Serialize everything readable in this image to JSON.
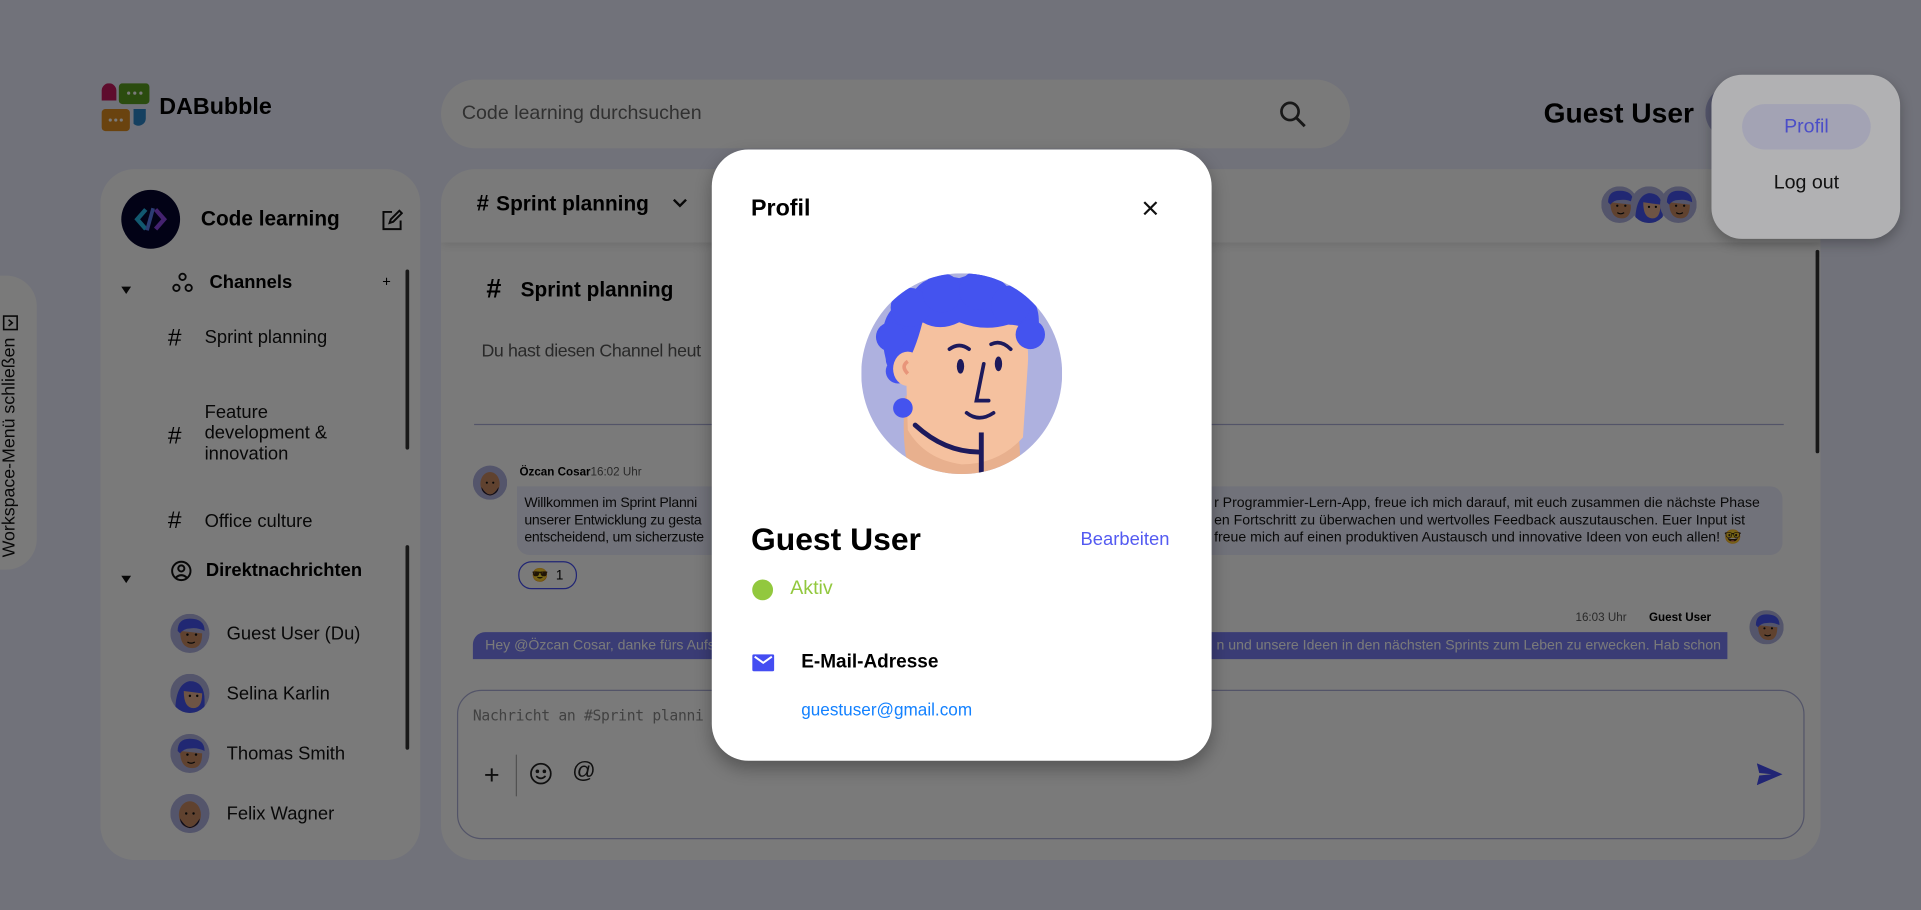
{
  "app": {
    "name": "DABubble"
  },
  "search": {
    "placeholder": "Code learning durchsuchen"
  },
  "header": {
    "user_name": "Guest User"
  },
  "user_menu": {
    "items": [
      {
        "label": "Profil"
      },
      {
        "label": "Log out"
      }
    ]
  },
  "workspace_toggle": {
    "label": "Workspace-Menü schließen"
  },
  "sidebar": {
    "workspace_name": "Code learning",
    "channels_title": "Channels",
    "channels": [
      {
        "label": "Sprint planning"
      },
      {
        "label": "Feature development & innovation"
      },
      {
        "label": "Office culture"
      }
    ],
    "dm_title": "Direktnachrichten",
    "dms": [
      {
        "label": "Guest User (Du)"
      },
      {
        "label": "Selina Karlin"
      },
      {
        "label": "Thomas Smith"
      },
      {
        "label": "Felix Wagner"
      }
    ]
  },
  "channel": {
    "title": "Sprint planning",
    "intro_title": "Sprint planning",
    "intro_text": "Du hast diesen Channel heut",
    "messages": [
      {
        "author": "Özcan Cosar",
        "time": "16:02 Uhr",
        "lines_left": [
          "Willkommen im Sprint Planni",
          "unserer Entwicklung zu gesta",
          "entscheidend, um sicherzuste"
        ],
        "lines_right": [
          "r Programmier-Lern-App, freue ich mich darauf, mit euch zusammen die nächste Phase",
          "en Fortschritt zu überwachen und wertvolles Feedback auszutauschen. Euer Input ist",
          "freue mich auf einen produktiven Austausch und innovative Ideen von euch allen! 🤓"
        ],
        "reaction": {
          "emoji": "😎",
          "count": "1"
        }
      },
      {
        "author": "Guest User",
        "time": "16:03 Uhr",
        "lines_left": [
          "Hey @Özcan Cosar, danke fürs Aufs"
        ],
        "lines_right": [
          "n und unsere Ideen in den nächsten Sprints zum Leben zu erwecken. Hab schon"
        ]
      }
    ],
    "input_placeholder": "Nachricht an #Sprint planni"
  },
  "profile_modal": {
    "title": "Profil",
    "name": "Guest User",
    "edit_label": "Bearbeiten",
    "status": "Aktiv",
    "email_label": "E-Mail-Adresse",
    "email": "guestuser@gmail.com"
  },
  "colors": {
    "accent": "#444df2",
    "status_active": "#92c83e",
    "link": "#1381ff",
    "edit": "#535af1"
  }
}
